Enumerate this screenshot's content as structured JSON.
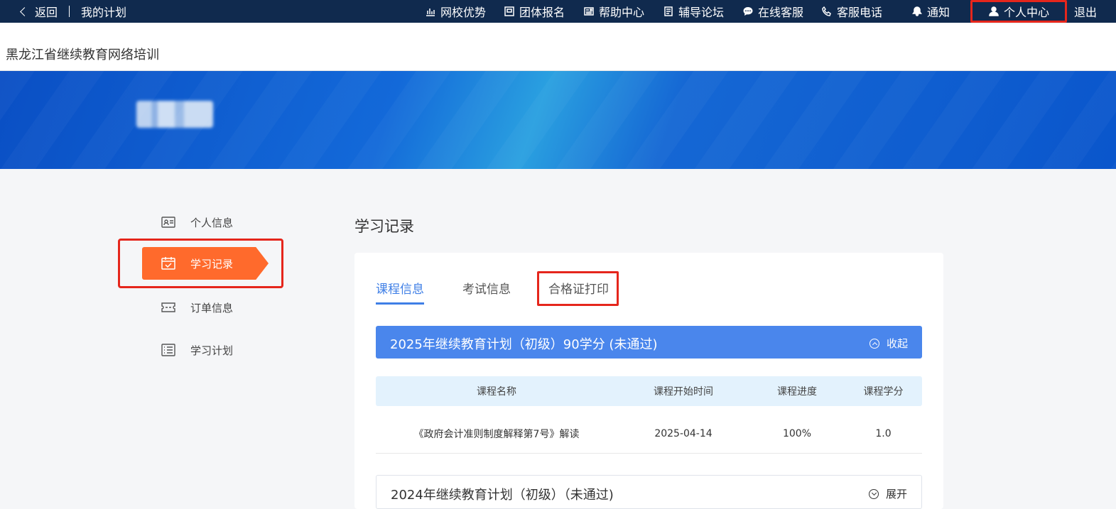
{
  "topnav": {
    "back_label": "返回",
    "my_plan_label": "我的计划",
    "items": [
      {
        "label": "网校优势",
        "icon": "bar-chart-icon"
      },
      {
        "label": "团体报名",
        "icon": "building-icon"
      },
      {
        "label": "帮助中心",
        "icon": "newspaper-icon"
      },
      {
        "label": "辅导论坛",
        "icon": "document-icon"
      },
      {
        "label": "在线客服",
        "icon": "chat-icon"
      },
      {
        "label": "客服电话",
        "icon": "phone-icon"
      },
      {
        "label": "通知",
        "icon": "bell-icon"
      },
      {
        "label": "个人中心",
        "icon": "user-icon"
      }
    ],
    "logout_label": "退出"
  },
  "subheader": {
    "site_title": "黑龙江省继续教育网络培训"
  },
  "sidebar": {
    "items": [
      {
        "label": "个人信息",
        "icon": "id-card-icon"
      },
      {
        "label": "学习记录",
        "icon": "calendar-check-icon",
        "active": true
      },
      {
        "label": "订单信息",
        "icon": "ticket-icon"
      },
      {
        "label": "学习计划",
        "icon": "list-icon"
      }
    ]
  },
  "main": {
    "title": "学习记录",
    "tabs": [
      {
        "label": "课程信息",
        "active": true
      },
      {
        "label": "考试信息",
        "active": false
      },
      {
        "label": "合格证打印",
        "active": false
      }
    ],
    "plans": [
      {
        "title": "2025年继续教育计划（初级）90学分 (未通过)",
        "toggle_label": "收起",
        "expanded": true,
        "columns": [
          "课程名称",
          "课程开始时间",
          "课程进度",
          "课程学分"
        ],
        "rows": [
          [
            "《政府会计准则制度解释第7号》解读",
            "2025-04-14",
            "100%",
            "1.0"
          ]
        ]
      },
      {
        "title": "2024年继续教育计划（初级）（未通过)",
        "toggle_label": "展开",
        "expanded": false
      }
    ]
  },
  "colors": {
    "topnav_bg": "#102a4e",
    "accent_orange": "#ff6a2c",
    "accent_blue": "#4a86ec",
    "highlight_red": "#e5261c"
  }
}
